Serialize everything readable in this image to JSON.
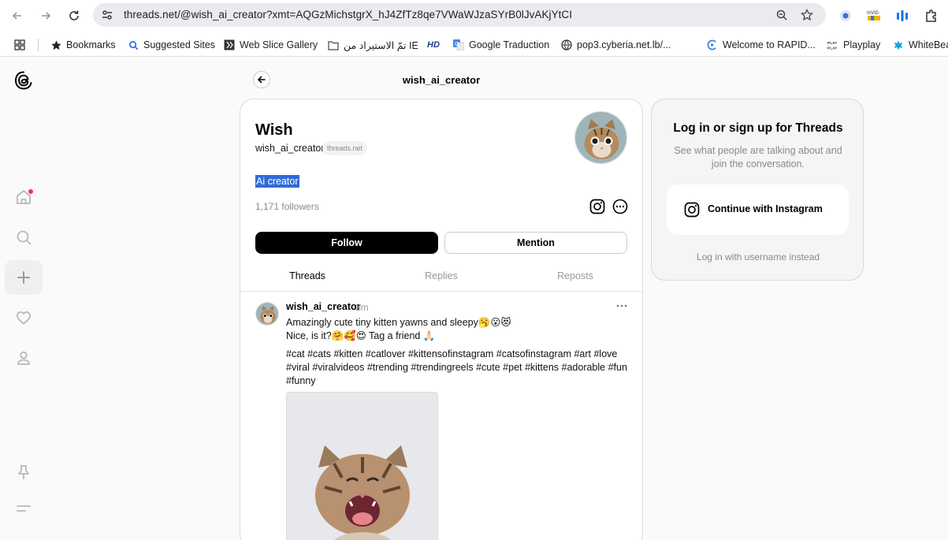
{
  "browser": {
    "url": "threads.net/@wish_ai_creator?xmt=AQGzMichstgrX_hJ4ZfTz8qe7VWaWJzaSYrB0lJvAKjYtCI",
    "bookmarks": [
      {
        "label": "Bookmarks",
        "icon": "star-icon"
      },
      {
        "label": "Suggested Sites",
        "icon": "search-icon"
      },
      {
        "label": "Web Slice Gallery",
        "icon": "slice-icon"
      },
      {
        "label": "تمّ الاستيراد من IE",
        "icon": "folder-icon"
      },
      {
        "label": "",
        "icon": "hd-icon",
        "text": "HD"
      },
      {
        "label": "Google Traduction",
        "icon": "translate-icon"
      },
      {
        "label": "pop3.cyberia.net.lb/...",
        "icon": "globe-icon"
      },
      {
        "label": "Welcome to RAPID...",
        "icon": "rapid-icon"
      },
      {
        "label": "Playplay",
        "icon": "playplay-icon"
      },
      {
        "label": "WhiteBea",
        "icon": "whitebear-icon"
      }
    ],
    "extensions": {
      "invid_label": "InVID"
    }
  },
  "header": {
    "title": "wish_ai_creator"
  },
  "profile": {
    "name": "Wish",
    "handle": "wish_ai_creator",
    "domain_badge": "threads.net",
    "bio": "Ai creator",
    "followers": "1,171 followers",
    "follow_label": "Follow",
    "mention_label": "Mention"
  },
  "tabs": [
    {
      "label": "Threads",
      "active": true
    },
    {
      "label": "Replies",
      "active": false
    },
    {
      "label": "Reposts",
      "active": false
    }
  ],
  "post": {
    "user": "wish_ai_creator",
    "time": "3m",
    "line1": "Amazingly cute tiny kitten yawns and sleepy🥱😮😻",
    "line2": "Nice, is it?🤗🥰😍 Tag a friend 🙏🏻",
    "hashtags1": "#cat #cats #kitten #catlover #kittensofinstagram #catsofinstagram #art #love",
    "hashtags2": "#viral #viralvideos #trending #trendingreels #cute #pet #kittens #adorable #fun",
    "hashtags3": "#funny"
  },
  "login": {
    "title": "Log in or sign up for Threads",
    "subtitle": "See what people are talking about and join the conversation.",
    "instagram_label": "Continue with Instagram",
    "alt_label": "Log in with username instead"
  },
  "colors": {
    "accent": "#000000",
    "selection": "#2f6bd6",
    "notify_dot": "#ff3040"
  }
}
